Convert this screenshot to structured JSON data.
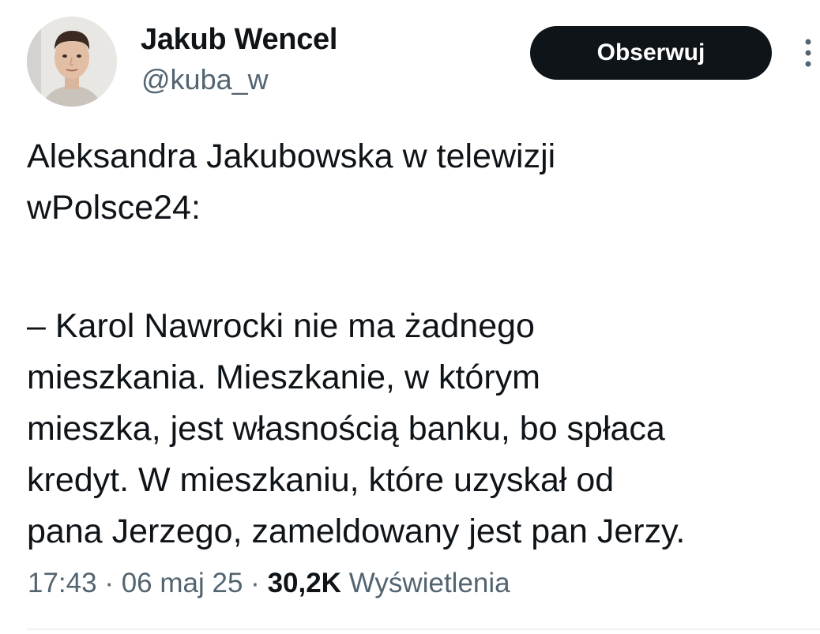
{
  "author": {
    "display_name": "Jakub Wencel",
    "handle": "@kuba_w"
  },
  "actions": {
    "follow_label": "Obserwuj",
    "more_icon": "more-vertical-icon"
  },
  "tweet": {
    "intro_lines": [
      "Aleksandra Jakubowska w telewizji",
      "wPolsce24:"
    ],
    "quote_lines": [
      "– Karol Nawrocki nie ma żadnego",
      "mieszkania. Mieszkanie, w którym",
      "mieszka, jest własnością banku, bo spłaca",
      "kredyt. W mieszkaniu, które uzyskał od",
      "pana Jerzego, zameldowany jest pan Jerzy."
    ]
  },
  "meta": {
    "time": "17:43",
    "separator": "·",
    "date": "06 maj 25",
    "views_count": "30,2K",
    "views_label": "Wyświetlenia"
  },
  "colors": {
    "text": "#0f1419",
    "secondary": "#536471",
    "button_bg": "#0f1419",
    "button_text": "#ffffff",
    "divider": "#eff3f4"
  }
}
